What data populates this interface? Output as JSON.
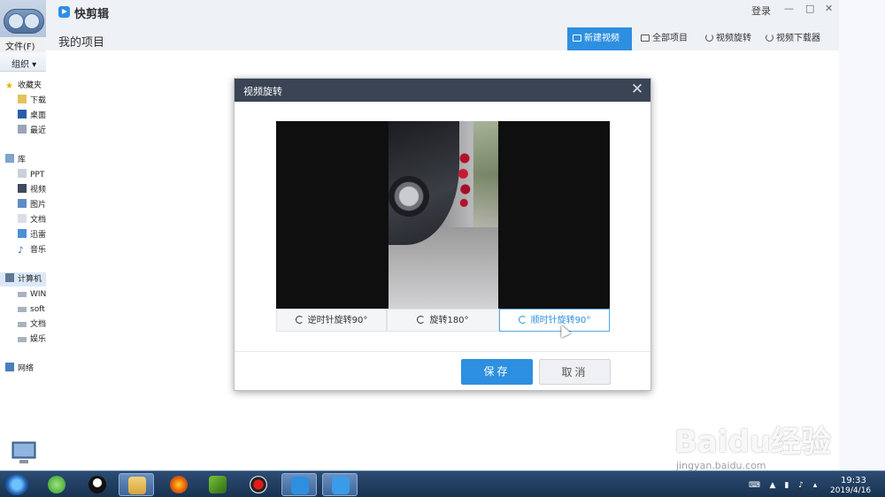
{
  "explorer": {
    "menubar": "文件(F)",
    "toolbar_organize": "组织 ▾",
    "nav": [
      {
        "label": "收藏夹",
        "icon": "star-icon"
      },
      {
        "label": "下载",
        "icon": "folder-icon"
      },
      {
        "label": "桌面",
        "icon": "desktop-icon"
      },
      {
        "label": "最近",
        "icon": "recent-icon"
      },
      {
        "label": "库",
        "icon": "library-icon"
      },
      {
        "label": "PPT",
        "icon": "folder-icon"
      },
      {
        "label": "视频",
        "icon": "video-icon"
      },
      {
        "label": "图片",
        "icon": "picture-icon"
      },
      {
        "label": "文档",
        "icon": "document-icon"
      },
      {
        "label": "迅雷",
        "icon": "thunder-icon"
      },
      {
        "label": "音乐",
        "icon": "music-icon"
      },
      {
        "label": "计算机",
        "icon": "computer-icon"
      },
      {
        "label": "WIN",
        "icon": "drive-icon"
      },
      {
        "label": "soft",
        "icon": "drive-icon"
      },
      {
        "label": "文档",
        "icon": "drive-icon"
      },
      {
        "label": "娱乐",
        "icon": "drive-icon"
      },
      {
        "label": "网络",
        "icon": "network-icon"
      }
    ]
  },
  "app": {
    "name": "快剪辑",
    "login": "登录",
    "page_title": "我的项目",
    "window_controls": [
      "—",
      "□",
      "✕"
    ],
    "tabs": [
      {
        "label": "新建视频",
        "icon": "video-camera-icon",
        "active": true
      },
      {
        "label": "全部项目",
        "icon": "folder-icon",
        "active": false
      },
      {
        "label": "视频旋转",
        "icon": "rotate-icon",
        "active": false
      },
      {
        "label": "视频下载器",
        "icon": "cloud-download-icon",
        "active": false
      }
    ]
  },
  "dialog": {
    "title": "视频旋转",
    "close": "✕",
    "rotate_ccw": "逆时针旋转90°",
    "rotate_180": "旋转180°",
    "rotate_cw": "顺时针旋转90°",
    "save": "保存",
    "cancel": "取消"
  },
  "watermark": {
    "logo": "Baidu经验",
    "url": "jingyan.baidu.com"
  },
  "taskbar": {
    "time": "19:33",
    "date": "2019/4/16",
    "apps": [
      "360-icon",
      "qq-icon",
      "file-explorer-icon",
      "firefox-icon",
      "video-editor-icon",
      "record-icon",
      "kuaijianji-icon",
      "rotate-app-icon"
    ]
  },
  "colors": {
    "accent": "#2d8fe0",
    "dialog_header": "#3a4454",
    "taskbar": "#173252"
  }
}
